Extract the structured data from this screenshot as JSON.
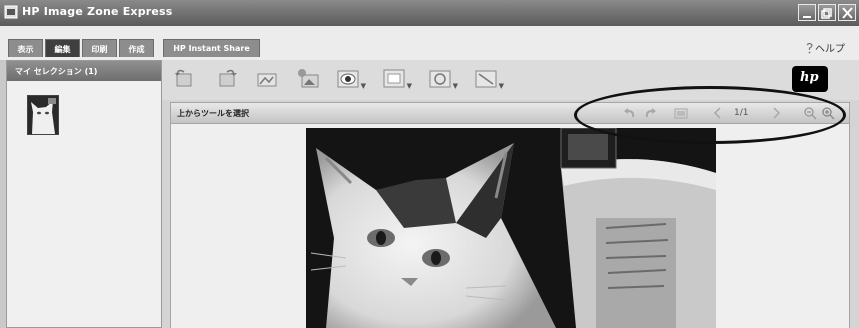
{
  "window": {
    "title": "HP Image Zone Express",
    "buttons": [
      "minimize",
      "maximize",
      "close"
    ]
  },
  "tabs": [
    {
      "label": "表示",
      "active": false
    },
    {
      "label": "編集",
      "active": true
    },
    {
      "label": "印刷",
      "active": false
    },
    {
      "label": "作成",
      "active": false
    },
    {
      "label": "HP Instant Share",
      "active": false
    }
  ],
  "help": {
    "label": "ヘルプ"
  },
  "left_panel": {
    "header": "マイ セレクション (1)"
  },
  "toolbar": {
    "tools": [
      "rotate-left-tool",
      "rotate-right-tool",
      "crop-tool",
      "enhance-tool",
      "redeye-tool",
      "frame-tool",
      "effect-tool",
      "text-tool"
    ],
    "brand": "hp"
  },
  "editor": {
    "header": "上からツールを選択",
    "page_indicator": "1/1"
  },
  "colors": {
    "titlebar": "#6b6b6b",
    "active_tab": "#3f3f3f",
    "panel": "#f0f0f0"
  }
}
